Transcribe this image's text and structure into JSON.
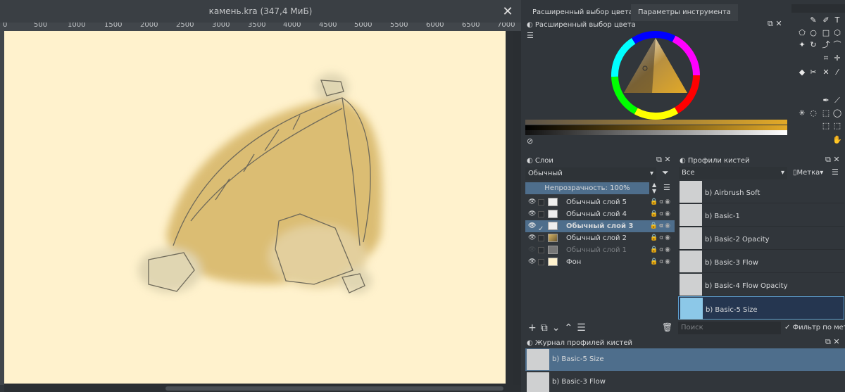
{
  "document": {
    "title": "камень.kra (347,4 МиБ)",
    "close": "✕"
  },
  "ruler": {
    "labels": [
      "0",
      "500",
      "1000",
      "1500",
      "2000",
      "2500",
      "3000",
      "3500",
      "4000",
      "4500",
      "5000",
      "5500",
      "6000",
      "6500",
      "7000"
    ]
  },
  "tabs": {
    "color": "Расширенный выбор цвета",
    "tool_options": "Параметры инструмента"
  },
  "color_panel": {
    "title": "Расширенный выбор цвета",
    "docker_buttons": "⧉ ✕",
    "accent": "#e2a927"
  },
  "layers_panel": {
    "title": "Слои",
    "blend_mode": "Обычный",
    "opacity_label": "Непрозрачность:  100%",
    "layers": [
      {
        "name": "Обычный слой 5",
        "visible": true,
        "selected": false,
        "thumb": "checker"
      },
      {
        "name": "Обычный слой 4",
        "visible": true,
        "selected": false,
        "thumb": "checker"
      },
      {
        "name": "Обычный слой 3",
        "visible": true,
        "selected": true,
        "thumb": "checker"
      },
      {
        "name": "Обычный слой 2",
        "visible": true,
        "selected": false,
        "thumb": "art"
      },
      {
        "name": "Обычный слой 1",
        "visible": false,
        "selected": false,
        "thumb": "gray"
      },
      {
        "name": "Фон",
        "visible": true,
        "selected": false,
        "thumb": "cream"
      }
    ]
  },
  "brush_panel": {
    "title": "Профили кистей",
    "filter": "Все",
    "tag_label": "Метка",
    "search_placeholder": "Поиск",
    "filter_label": "Фильтр по мет",
    "brushes": [
      "b) Airbrush Soft",
      "b) Basic-1",
      "b) Basic-2 Opacity",
      "b) Basic-3 Flow",
      "b) Basic-4 Flow Opacity",
      "b) Basic-5 Size"
    ],
    "selected": "b) Basic-5 Size"
  },
  "history_panel": {
    "title": "Журнал профилей кистей",
    "items": [
      "b) Basic-5 Size",
      "b) Basic-3 Flow"
    ]
  }
}
